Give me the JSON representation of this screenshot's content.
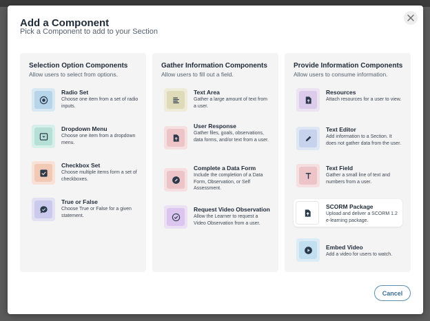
{
  "modal": {
    "title": "Add a Component",
    "subtitle": "Pick a Component to add to your Section",
    "cancel_label": "Cancel"
  },
  "columns": [
    {
      "heading": "Selection Option Components",
      "subheading": "Allow users to select from options.",
      "items": [
        {
          "name": "Radio Set",
          "desc": "Choose one item from a set of radio inputs.",
          "icon": "radio-icon"
        },
        {
          "name": "Dropdown Menu",
          "desc": "Choose one item from a dropdown menu.",
          "icon": "dropdown-icon"
        },
        {
          "name": "Checkbox Set",
          "desc": "Choose multiple items form a set of checkboxes.",
          "icon": "checkbox-icon"
        },
        {
          "name": "True or False",
          "desc": "Choose True or False for a given statement.",
          "icon": "chat-check-icon"
        }
      ]
    },
    {
      "heading": "Gather Information Components",
      "subheading": "Allow users to fill out a field.",
      "items": [
        {
          "name": "Text Area",
          "desc": "Gather a large amount of text from a user.",
          "icon": "text-lines-icon"
        },
        {
          "name": "User Response",
          "desc": "Gather files, goals, observations, data forms, and/or text from a user.",
          "icon": "file-upload-icon"
        },
        {
          "name": "Complete a Data Form",
          "desc": "Include the completion of a Data Form, Observation, or Self Assessment.",
          "icon": "form-pen-icon"
        },
        {
          "name": "Request Video Observation",
          "desc": "Allow the Learner to request a Video Observation from a user.",
          "icon": "check-circle-icon"
        }
      ]
    },
    {
      "heading": "Provide Information Components",
      "subheading": "Allow users to consume information.",
      "items": [
        {
          "name": "Resources",
          "desc": "Attach resources for a user to view.",
          "icon": "resource-file-icon"
        },
        {
          "name": "Text Editor",
          "desc": "Add information to a Section. It does not gather data from the user.",
          "icon": "pencil-icon"
        },
        {
          "name": "Text Field",
          "desc": "Gather a small line of text and numbers from a user.",
          "icon": "text-t-icon"
        },
        {
          "name": "SCORM Package",
          "desc": "Upload and deliver a SCORM 1.2 e-learning package.",
          "icon": "scorm-file-icon"
        },
        {
          "name": "Embed Video",
          "desc": "Add a video for users to watch.",
          "icon": "play-icon"
        }
      ]
    }
  ]
}
